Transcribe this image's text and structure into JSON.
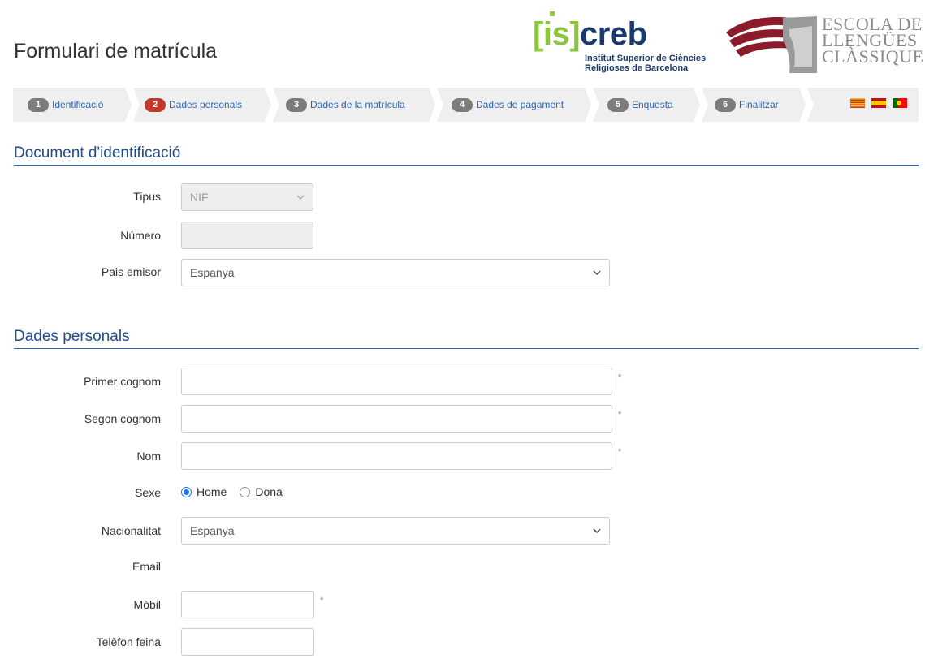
{
  "header": {
    "title": "Formulari de matrícula",
    "logo_iscreb": {
      "mark_bracket_open": "[",
      "mark_is": "is",
      "mark_bracket_close": "]",
      "mark_creb": "creb",
      "subtitle_line1": "Institut Superior de Ciències",
      "subtitle_line2": "Religioses de Barcelona"
    },
    "logo_escola": {
      "line1": "ESCOLA DE",
      "line2": "LLENGÜES",
      "line3": "CLÀSSIQUES"
    }
  },
  "steps": [
    {
      "num": "1",
      "label": "Identificació",
      "active": false
    },
    {
      "num": "2",
      "label": "Dades personals",
      "active": true
    },
    {
      "num": "3",
      "label": "Dades de la matrícula",
      "active": false
    },
    {
      "num": "4",
      "label": "Dades de pagament",
      "active": false
    },
    {
      "num": "5",
      "label": "Enquesta",
      "active": false
    },
    {
      "num": "6",
      "label": "Finalitzar",
      "active": false
    }
  ],
  "languages": [
    "flag-catalan-icon",
    "flag-spain-icon",
    "flag-portugal-icon"
  ],
  "document_section": {
    "title": "Document d'identificació",
    "tipus_label": "Tipus",
    "tipus_value": "NIF",
    "numero_label": "Número",
    "numero_value": "",
    "pais_label": "Pais emisor",
    "pais_value": "Espanya"
  },
  "personal_section": {
    "title": "Dades personals",
    "primer_cognom_label": "Primer cognom",
    "segon_cognom_label": "Segon cognom",
    "nom_label": "Nom",
    "sexe_label": "Sexe",
    "sexe_options": [
      "Home",
      "Dona"
    ],
    "sexe_selected": "Home",
    "nacionalitat_label": "Nacionalitat",
    "nacionalitat_value": "Espanya",
    "email_label": "Email",
    "mobil_label": "Mòbil",
    "telefon_label": "Telèfon feina",
    "required_mark": "*"
  },
  "colors": {
    "accent": "#2a66b8",
    "section_title": "#1f4d8c",
    "step_active": "#c0392b",
    "step_inactive": "#7c7c7c",
    "logo_green": "#8cc63f",
    "logo_navy": "#1a3a6e",
    "logo_wine": "#8b1a2b"
  }
}
